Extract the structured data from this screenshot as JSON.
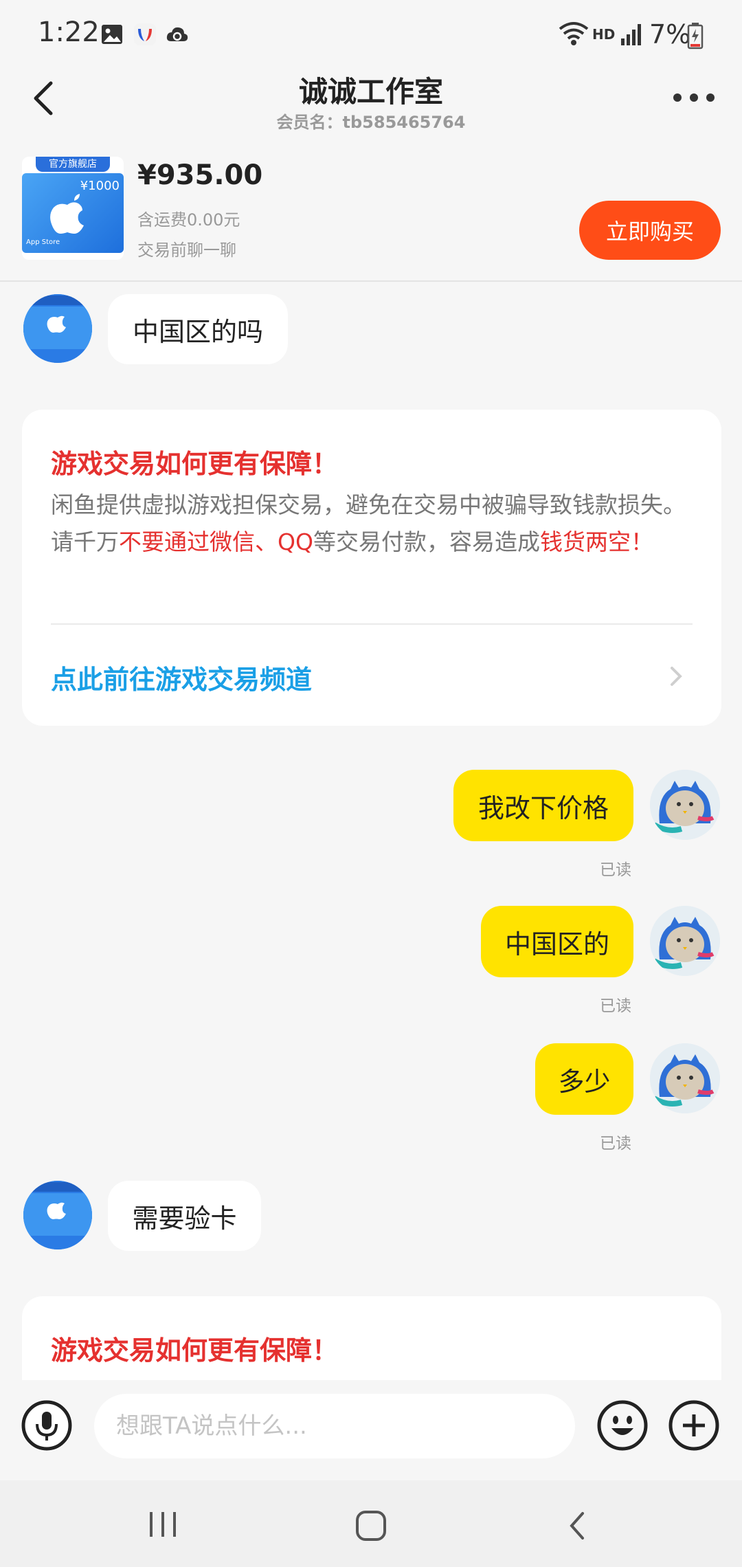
{
  "status": {
    "time": "1:22",
    "network": "HD",
    "battery": "7%"
  },
  "header": {
    "title": "诚诚工作室",
    "subtitle": "会员名：tb585465764"
  },
  "product": {
    "badge": "官方旗舰店",
    "card_value": "¥1000",
    "card_store": "App Store",
    "price": "¥935.00",
    "shipping": "含运费0.00元",
    "note": "交易前聊一聊",
    "buy_label": "立即购买"
  },
  "messages": {
    "m1": "中国区的吗",
    "m2": "我改下价格",
    "m3": "中国区的",
    "m4": "多少",
    "m5": "需要验卡",
    "read": "已读"
  },
  "notice": {
    "title": "游戏交易如何更有保障！",
    "body_1": "闲鱼提供虚拟游戏担保交易，避免在交易中被骗导致钱款损失。请千万",
    "body_red_1": "不要通过微信、QQ",
    "body_2": "等交易付款，容易造成",
    "body_red_2": "钱货两空",
    "body_3": "！",
    "link": "点此前往游戏交易频道"
  },
  "input": {
    "placeholder": "想跟TA说点什么..."
  },
  "colors": {
    "accent": "#ff4d17",
    "bubble_self": "#ffe300",
    "warning": "#e5312f",
    "link": "#1a9fe6"
  }
}
